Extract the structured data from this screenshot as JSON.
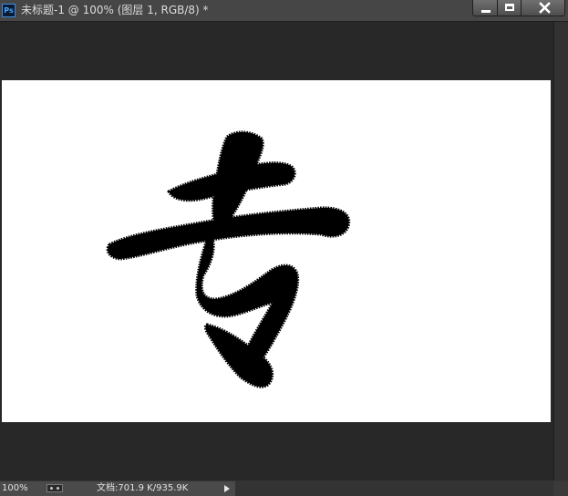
{
  "window": {
    "app_icon": "photoshop-icon",
    "app_icon_text": "Ps",
    "title": "未标题-1 @ 100% (图层 1, RGB/8) *"
  },
  "window_controls": {
    "minimize": "minimize-icon",
    "maximize": "maximize-icon",
    "close": "close-icon"
  },
  "canvas": {
    "background": "#ffffff",
    "content": "brush-calligraphy-character"
  },
  "status_bar": {
    "zoom": "100%",
    "doc_info": "文档:701.9 K/935.9K"
  },
  "colors": {
    "workspace": "#282828",
    "titlebar": "#464646",
    "statusbar": "#4a4a4a",
    "ink": "#000000"
  }
}
